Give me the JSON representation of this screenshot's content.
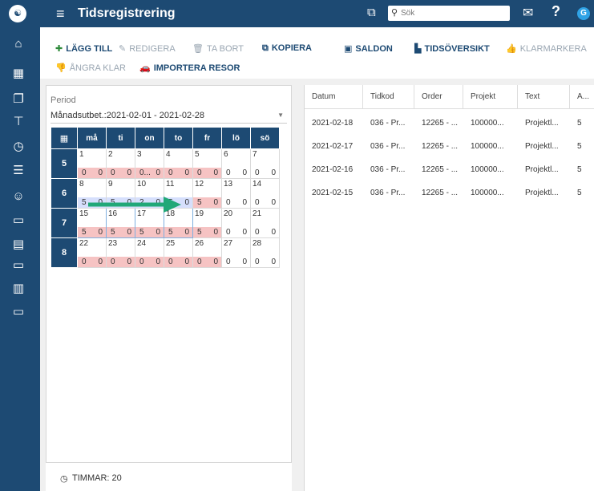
{
  "app": {
    "title": "Tidsregistrering",
    "user_initial": "G"
  },
  "search": {
    "placeholder": "Sök",
    "value": ""
  },
  "toolbar": {
    "add": "LÄGG TILL",
    "edit": "REDIGERA",
    "delete": "TA BORT",
    "copy": "KOPIERA",
    "balances": "SALDON",
    "overview": "TIDSÖVERSIKT",
    "mark_done": "KLARMARKERA",
    "undo_done": "ÅNGRA KLAR",
    "import_trips": "IMPORTERA RESOR"
  },
  "period": {
    "label": "Period",
    "selected": "Månadsutbet.:2021-02-01 - 2021-02-28"
  },
  "calendar": {
    "weekdays": [
      "må",
      "ti",
      "on",
      "to",
      "fr",
      "lö",
      "sö"
    ],
    "weeks": [
      {
        "week": "5",
        "days": [
          {
            "num": "1",
            "h1": "0",
            "h2": "0",
            "style": "pink"
          },
          {
            "num": "2",
            "h1": "0",
            "h2": "0",
            "style": "pink"
          },
          {
            "num": "3",
            "h1": "0...",
            "h2": "0",
            "style": "pink"
          },
          {
            "num": "4",
            "h1": "0",
            "h2": "0",
            "style": "pink"
          },
          {
            "num": "5",
            "h1": "0",
            "h2": "0",
            "style": "pink"
          },
          {
            "num": "6",
            "h1": "0",
            "h2": "0",
            "style": "white"
          },
          {
            "num": "7",
            "h1": "0",
            "h2": "0",
            "style": "white"
          }
        ]
      },
      {
        "week": "6",
        "days": [
          {
            "num": "8",
            "h1": "5",
            "h2": "0",
            "style": "blue"
          },
          {
            "num": "9",
            "h1": "5",
            "h2": "0",
            "style": "blue"
          },
          {
            "num": "10",
            "h1": "2...",
            "h2": "0",
            "style": "blue"
          },
          {
            "num": "11",
            "h1": "5",
            "h2": "0",
            "style": "blue"
          },
          {
            "num": "12",
            "h1": "5",
            "h2": "0",
            "style": "pink"
          },
          {
            "num": "13",
            "h1": "0",
            "h2": "0",
            "style": "white"
          },
          {
            "num": "14",
            "h1": "0",
            "h2": "0",
            "style": "white"
          }
        ]
      },
      {
        "week": "7",
        "days": [
          {
            "num": "15",
            "h1": "5",
            "h2": "0",
            "style": "pink",
            "selected": true
          },
          {
            "num": "16",
            "h1": "5",
            "h2": "0",
            "style": "pink",
            "selected": true
          },
          {
            "num": "17",
            "h1": "5",
            "h2": "0",
            "style": "pink",
            "selected": true
          },
          {
            "num": "18",
            "h1": "5",
            "h2": "0",
            "style": "pink",
            "selected": true
          },
          {
            "num": "19",
            "h1": "5",
            "h2": "0",
            "style": "pink"
          },
          {
            "num": "20",
            "h1": "0",
            "h2": "0",
            "style": "white"
          },
          {
            "num": "21",
            "h1": "0",
            "h2": "0",
            "style": "white"
          }
        ]
      },
      {
        "week": "8",
        "days": [
          {
            "num": "22",
            "h1": "0",
            "h2": "0",
            "style": "pink"
          },
          {
            "num": "23",
            "h1": "0",
            "h2": "0",
            "style": "pink"
          },
          {
            "num": "24",
            "h1": "0",
            "h2": "0",
            "style": "pink"
          },
          {
            "num": "25",
            "h1": "0",
            "h2": "0",
            "style": "pink"
          },
          {
            "num": "26",
            "h1": "0",
            "h2": "0",
            "style": "pink"
          },
          {
            "num": "27",
            "h1": "0",
            "h2": "0",
            "style": "white"
          },
          {
            "num": "28",
            "h1": "0",
            "h2": "0",
            "style": "white"
          }
        ]
      }
    ]
  },
  "summary": {
    "label": "TIMMAR: 20"
  },
  "grid": {
    "columns": [
      "Datum",
      "Tidkod",
      "Order",
      "Projekt",
      "Text",
      "A..."
    ],
    "rows": [
      [
        "2021-02-18",
        "036 - Pr...",
        "12265 - ...",
        "100000...",
        "Projektl...",
        "5"
      ],
      [
        "2021-02-17",
        "036 - Pr...",
        "12265 - ...",
        "100000...",
        "Projektl...",
        "5"
      ],
      [
        "2021-02-16",
        "036 - Pr...",
        "12265 - ...",
        "100000...",
        "Projektl...",
        "5"
      ],
      [
        "2021-02-15",
        "036 - Pr...",
        "12265 - ...",
        "100000...",
        "Projektl...",
        "5"
      ]
    ]
  },
  "colors": {
    "primary": "#1d4a73",
    "accent_green": "#2e8a3a",
    "arrow_teal": "#21a878",
    "pink": "#f6c3c3"
  },
  "icons": [
    "logo-icon",
    "home-icon",
    "calculator-icon",
    "files-icon",
    "org-chart-icon",
    "clock-icon",
    "group-icon",
    "people-icon",
    "money-icon",
    "truck-icon",
    "cash-icon",
    "bar-chart-icon",
    "laptop-icon"
  ]
}
